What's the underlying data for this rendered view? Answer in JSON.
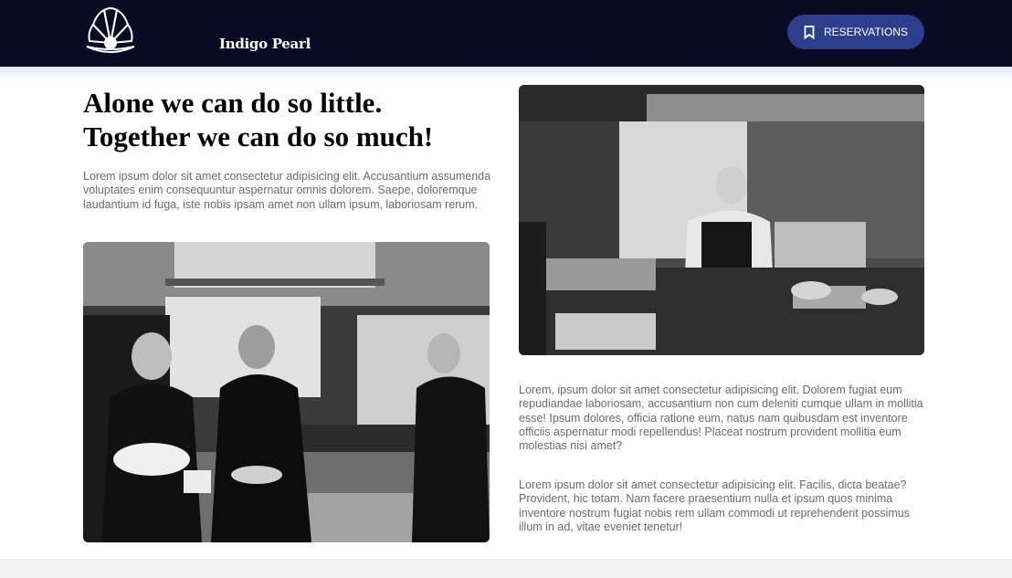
{
  "header": {
    "brand_name": "Indigo Pearl",
    "logo_icon": "shell-pearl-icon",
    "reservations_label": "RESERVATIONS",
    "reservations_icon": "bookmark-icon"
  },
  "main": {
    "headline_line1": "Alone we can do so little.",
    "headline_line2": "Together we can do so much!",
    "intro_text": "Lorem ipsum dolor sit amet consectetur adipisicing elit. Accusantium assumenda voluptates enim consequuntur aspernatur omnis dolorem. Saepe, doloremque laudantium id fuga, iste nobis ipsam amet non ullam ipsum, laboriosam rerum.",
    "paragraph_1": "Lorem, ipsum dolor sit amet consectetur adipisicing elit. Dolorem fugiat eum repudiandae laboriosam, accusantium non cum deleniti cumque ullam in mollitia esse! Ipsum dolores, officia ratione eum, natus nam quibusdam est inventore officiis aspernatur modi repellendus! Placeat nostrum provident mollitia eum molestias nisi amet?",
    "paragraph_2": "Lorem ipsum dolor sit amet consectetur adipisicing elit. Facilis, dicta beatae? Provident, hic totam. Nam facere praesentium nulla et ipsum quos minima inventore nostrum fugiat nobis rem ullam commodi ut reprehenderit possimus illum in ad, vitae eveniet tenetur!"
  },
  "colors": {
    "header_bg": "#090a24",
    "button_bg": "#2d3f8c",
    "text_gray": "#6b6b6b",
    "headline": "#000000"
  }
}
